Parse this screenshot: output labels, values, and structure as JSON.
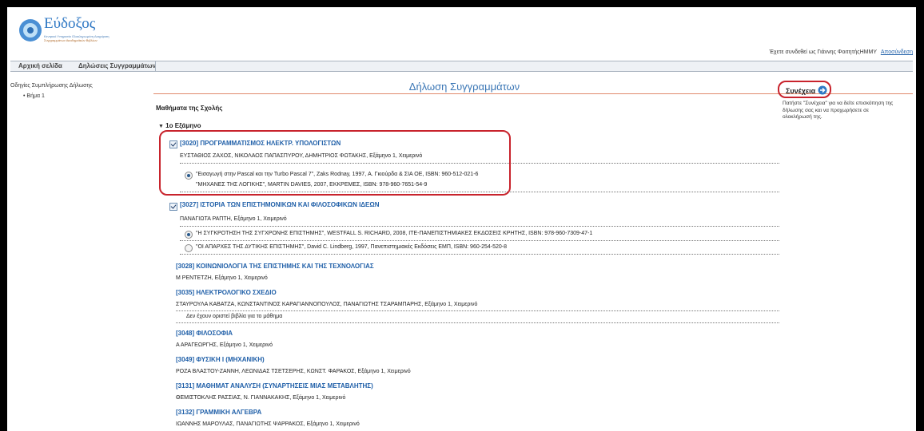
{
  "logo": {
    "name": "Εύδοξος",
    "sub1": "Κεντρικό Υπηρεσία Ολοκληρωμένη Διαχείριση",
    "sub2": "Συγγραμμάτων Ακαδημαϊκών Βιβλίων"
  },
  "user_bar": {
    "text": "Έχετε συνδεθεί ως Γιάννης ΦοιτητήςΗΜΜΥ",
    "logout": "Αποσύνδεση"
  },
  "nav": [
    "Αρχική σελίδα",
    "Δηλώσεις Συγγραμμάτων"
  ],
  "sidebar": {
    "title": "Οδηγίες Συμπλήρωσης Δήλωσης",
    "step": "Βήμα 1"
  },
  "main": {
    "title": "Δήλωση Συγγραμμάτων",
    "section": "Μαθήματα της Σχολής",
    "semester": "1ο Εξάμηνο",
    "continue_label": "Συνέχεια",
    "help": [
      "Πατήστε \"Συνέχεια\" για να δείτε επισκόπηση της",
      "δήλωσης σας και να προχωρήσετε σε",
      "ολοκλήρωσή της."
    ]
  },
  "courses": [
    {
      "title": "[3020] ΠΡΟΓΡΑΜΜΑΤΙΣΜΟΣ ΗΛΕΚΤΡ. ΥΠΟΛΟΓΙΣΤΩΝ",
      "sub": "ΕΥΣΤΑΘΙΟΣ ΖΑΧΟΣ, ΝΙΚΟΛΑΟΣ ΠΑΠΑΣΠΥΡΟΥ, ΔΗΜΗΤΡΙΟΣ ΦΩΤΑΚΗΣ, Εξάμηνο 1, Χειμερινό",
      "books": [
        {
          "line1": "\"Εισαγωγή στην Pascal και την Turbo Pascal 7\", Zaks Rodnay, 1997, Α. Γκιούρδα & ΣΙΑ ΟΕ, ISBN: 960-512-021-6",
          "line2": "\"ΜΗΧΑΝΕΣ ΤΗΣ ΛΟΓΙΚΗΣ\", MARTIN DAVIES, 2007, ΕΚΚΡΕΜΕΣ, ISBN: 978-960-7651-54-9",
          "selected": true
        }
      ]
    },
    {
      "title": "[3027] ΙΣΤΟΡΙΑ ΤΩΝ ΕΠΙΣΤΗΜΟΝΙΚΩΝ ΚΑΙ ΦΙΛΟΣΟΦΙΚΩΝ ΙΔΕΩΝ",
      "sub": "ΠΑΝΑΓΙΩΤΑ ΡΑΠΤΗ, Εξάμηνο 1, Χειμερινό",
      "books": [
        {
          "line1": "\"Η ΣΥΓΚΡΟΤΗΣΗ ΤΗΣ ΣΥΓΧΡΟΝΗΣ ΕΠΙΣΤΗΜΗΣ\", WESTFALL S. RICHARD, 2008, ΙΤΕ-ΠΑΝΕΠΙΣΤΗΜΙΑΚΕΣ ΕΚΔΟΣΕΙΣ ΚΡΗΤΗΣ, ISBN: 978-960-7309-47-1",
          "selected": true
        },
        {
          "line1": "\"ΟΙ ΑΠΑΡΧΕΣ ΤΗΣ ΔΥΤΙΚΗΣ ΕΠΙΣΤΗΜΗΣ\", David C. Lindberg, 1997, Πανεπιστημιακές Εκδόσεις ΕΜΠ, ISBN: 960-254-520-8",
          "selected": false
        }
      ]
    },
    {
      "title": "[3028] ΚΟΙΝΩΝΙΟΛΟΓΙΑ ΤΗΣ ΕΠΙΣΤΗΜΗΣ ΚΑΙ ΤΗΣ ΤΕΧΝΟΛΟΓΙΑΣ",
      "sub": "Μ ΡΕΝΤΕΤΖΗ, Εξάμηνο 1, Χειμερινό"
    },
    {
      "title": "[3035] ΗΛΕΚΤΡΟΛΟΓΙΚΟ ΣΧΕΔΙΟ",
      "sub": "ΣΤΑΥΡΟΥΛΑ ΚΑΒΑΤΖΑ, ΚΩΝΣΤΑΝΤΙΝΟΣ ΚΑΡΑΓΙΑΝΝΟΠΟΥΛΟΣ, ΠΑΝΑΓΙΩΤΗΣ ΤΣΑΡΑΜΠΑΡΗΣ, Εξάμηνο 1, Χειμερινό",
      "nobooks": "Δεν έχουν οριστεί βιβλία για το μάθημα"
    },
    {
      "title": "[3048] ΦΙΛΟΣΟΦΙΑ",
      "sub": "Α ΑΡΑΓΕΩΡΓΗΣ, Εξάμηνο 1, Χειμερινό"
    },
    {
      "title": "[3049] ΦΥΣΙΚΗ Ι (ΜΗΧΑΝΙΚΗ)",
      "sub": "ΡΟΖΑ ΒΛΑΣΤΟΥ-ΖΑΝΝΗ, ΛΕΩΝΙΔΑΣ ΤΣΕΤΣΕΡΗΣ, ΚΩΝΣΤ. ΦΑΡΑΚΟΣ, Εξάμηνο 1, Χειμερινό"
    },
    {
      "title": "[3131] ΜΑΘΗΜΑΤ ΑΝΑΛΥΣΗ (ΣΥΝΑΡΤΗΣΕΙΣ ΜΙΑΣ ΜΕΤΑΒΛΗΤΗΣ)",
      "sub": "ΘΕΜΙΣΤΟΚΛΗΣ ΡΑΣΣΙΑΣ, Ν. ΓΙΑΝΝΑΚΑΚΗΣ, Εξάμηνο 1, Χειμερινό"
    },
    {
      "title": "[3132] ΓΡΑΜΜΙΚΗ ΑΛΓΕΒΡΑ",
      "sub": "ΙΩΑΝΝΗΣ ΜΑΡΟΥΛΑΣ, ΠΑΝΑΓΙΩΤΗΣ ΨΑΡΡΑΚΟΣ, Εξάμηνο 1, Χειμερινό"
    }
  ]
}
